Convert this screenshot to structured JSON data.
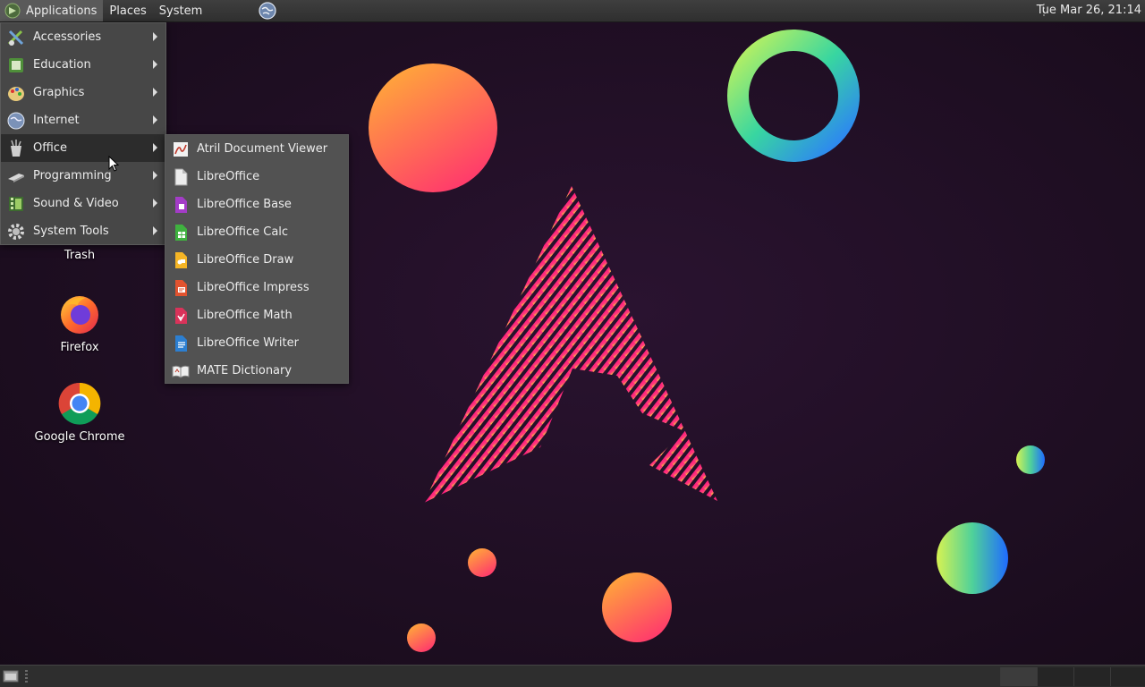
{
  "top_panel": {
    "applications": "Applications",
    "places": "Places",
    "system": "System",
    "clock": "Tue Mar 26, 21:14"
  },
  "desktop_icons": [
    {
      "label": "Trash"
    },
    {
      "label": "Firefox"
    },
    {
      "label": "Google Chrome"
    }
  ],
  "apps_menu": {
    "items": [
      {
        "label": "Accessories",
        "icon": "accessories-icon"
      },
      {
        "label": "Education",
        "icon": "education-icon"
      },
      {
        "label": "Graphics",
        "icon": "graphics-icon"
      },
      {
        "label": "Internet",
        "icon": "internet-icon"
      },
      {
        "label": "Office",
        "icon": "office-icon",
        "selected": true
      },
      {
        "label": "Programming",
        "icon": "programming-icon"
      },
      {
        "label": "Sound & Video",
        "icon": "sound-video-icon"
      },
      {
        "label": "System Tools",
        "icon": "system-tools-icon"
      }
    ]
  },
  "office_menu": {
    "items": [
      {
        "label": "Atril Document Viewer",
        "icon": "atril-icon"
      },
      {
        "label": "LibreOffice",
        "icon": "libreoffice-icon"
      },
      {
        "label": "LibreOffice Base",
        "icon": "libreoffice-base-icon"
      },
      {
        "label": "LibreOffice Calc",
        "icon": "libreoffice-calc-icon"
      },
      {
        "label": "LibreOffice Draw",
        "icon": "libreoffice-draw-icon"
      },
      {
        "label": "LibreOffice Impress",
        "icon": "libreoffice-impress-icon"
      },
      {
        "label": "LibreOffice Math",
        "icon": "libreoffice-math-icon"
      },
      {
        "label": "LibreOffice Writer",
        "icon": "libreoffice-writer-icon"
      },
      {
        "label": "MATE Dictionary",
        "icon": "mate-dictionary-icon"
      }
    ]
  },
  "colors": {
    "background": "#1b0c1d",
    "panel": "#3a3a3a",
    "menu": "#4a4a4a",
    "menu_selected": "#2c2c2c",
    "calc_green": "#3fb23f",
    "base_purple": "#a33cc7",
    "draw_yellow": "#f5b525",
    "impress_orange": "#e2532f",
    "math_red": "#d9335a",
    "writer_blue": "#2c7fd1"
  }
}
